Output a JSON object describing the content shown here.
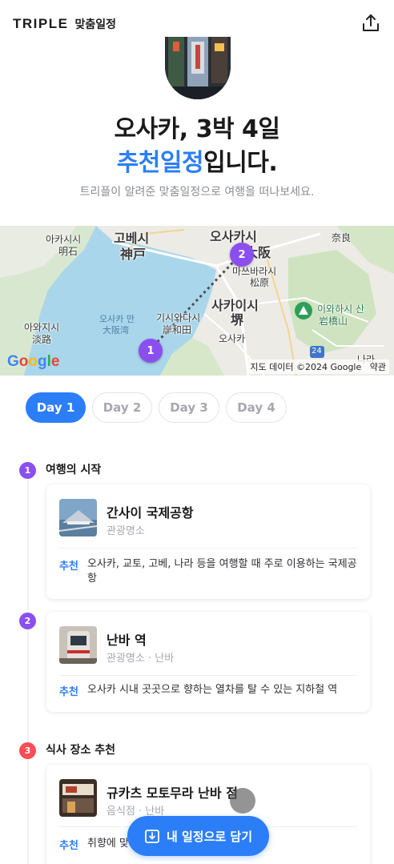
{
  "header": {
    "logo": "TRIPLE",
    "logo_sub": "맞춤일정"
  },
  "hero": {
    "title_line1": "오사카, 3박 4일",
    "title_accent": "추천일정",
    "title_suffix": "입니다.",
    "subtitle": "트리플이 알려준 맞춤일정으로 여행을 떠나보세요."
  },
  "map": {
    "labels": {
      "akashi": "아카시시",
      "akashi_kanji": "明石",
      "kobe": "고베시",
      "kobe_kanji": "神戸",
      "osaka_city": "오사카시",
      "osaka_kanji": "大阪",
      "nara_kanji": "奈良",
      "matsubara": "마쓰바라시",
      "matsubara_kanji": "松原",
      "sakai": "사카이시",
      "sakai_kanji": "堺",
      "osaka_bay": "오사카 만",
      "osaka_bay_kanji": "大阪湾",
      "kishiwada": "기시와다시",
      "kishiwada_kanji": "岸和田",
      "awaji": "아와지시",
      "awaji_kanji": "淡路",
      "iwaki": "이와하시 산",
      "iwaki_kanji": "岩橋山",
      "osaka_road": "오사카",
      "nara": "나라",
      "route_24": "24"
    },
    "pins": [
      "1",
      "2"
    ],
    "attribution": "지도 데이터 ©2024 Google",
    "terms": "약관"
  },
  "days": [
    "Day 1",
    "Day 2",
    "Day 3",
    "Day 4"
  ],
  "active_day": "Day 1",
  "sections": {
    "s1_num": "1",
    "s1_title": "여행의 시작",
    "s2_num": "2",
    "s3_num": "3",
    "s3_title": "식사 장소 추천"
  },
  "places": [
    {
      "name": "간사이 국제공항",
      "category": "관광명소",
      "rec_label": "추천",
      "rec_text": "오사카, 교토, 고베, 나라 등을 여행할 때 주로 이용하는 국제공항"
    },
    {
      "name": "난바 역",
      "category": "관광명소 · 난바",
      "rec_label": "추천",
      "rec_text": "오사카 시내 곳곳으로 향하는 열차를 탈 수 있는 지하철 역"
    },
    {
      "name": "규카츠 모토무라 난바 점",
      "category": "음식점 · 난바",
      "rec_label": "추천",
      "rec_text": "취향에 맞게 구워 먹는 규카츠 전문점"
    }
  ],
  "floating_button": {
    "label": "내 일정으로 담기"
  },
  "colors": {
    "accent": "#2c7ef8",
    "pin_purple": "#8b4ff0",
    "step_red": "#fa4d56"
  }
}
